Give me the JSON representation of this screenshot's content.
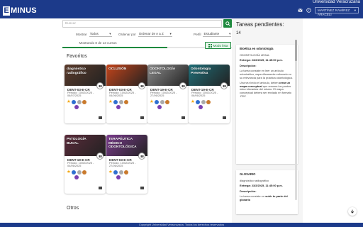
{
  "header": {
    "institution": "Universidad Veracruzana",
    "logo_initial": "E",
    "logo_rest": "MINUS",
    "user_name": "MARTÍNEZ RAMÍREZ ARACELI",
    "icons": [
      "mail-icon",
      "help-icon"
    ]
  },
  "search": {
    "placeholder": "Buscar",
    "button_icon": "search-icon"
  },
  "filters": {
    "show_label": "Mostrar",
    "show_value": "Todos",
    "order_label": "Ordenar por",
    "order_value": "Ordenar de A a Z",
    "profile_label": "Perfil",
    "profile_value": "Estudiante"
  },
  "showing_text": "Mostrando 8 de 13 cursos",
  "progress_fraction": 0.615,
  "mode_button": "Modo lista",
  "sections": {
    "favorites": "Favoritos",
    "others": "Otros"
  },
  "courses": [
    {
      "title": "diagnóstico radiográfico",
      "code": "DENT-03-E-CR",
      "period_1": "Periodo: 10/02/2025 -",
      "period_2": "06/07/2025",
      "color": "#5a3a2a"
    },
    {
      "title": "OCLUSIÓN",
      "code": "DENT-03-E-CR",
      "period_1": "Periodo: 10/02/2025 -",
      "period_2": "04/06/2025",
      "color": "#c4441a"
    },
    {
      "title": "ODONTOLOGÍA LEGAL",
      "code": "DENT-19-E-CR",
      "period_1": "Periodo: 10/02/2025 -",
      "period_2": "27/06/2025",
      "color": "#8a8a8a"
    },
    {
      "title": "Odontología Preventiva",
      "code": "DENT-19-E-CR",
      "period_1": "Periodo: 10/02/2025 -",
      "period_2": "06/06/2025",
      "color": "#1f6e78"
    },
    {
      "title": "PATOLOGÍA BUCAL",
      "code": "DENT-19-E-CR",
      "period_1": "Periodo: 10/02/2025 -",
      "period_2": "04/06/2025",
      "color": "#5a2b3a"
    },
    {
      "title": "TERAPÉUTICA MÉDICO ODONTOLÓGICA",
      "code": "DENT-03-E-CR",
      "period_1": "Periodo: 10/02/2025 -",
      "period_2": "27/06/2025",
      "color": "#7a3b8c"
    }
  ],
  "pending": {
    "title": "Tareas pendientes:",
    "count": "14",
    "tasks": [
      {
        "name": "Bioética en odontología",
        "course": "ODONTOLOGÍA LEGAL",
        "due": "Entrega: 23/2/2025, 11:45:00 p.m.",
        "desc_label": "Descripción:",
        "desc_1": "La tarea consiste en leer un artículo odontoético, específicamente enfocado en su relevancia para la práctica odontológica.",
        "desc_2_pre": "Una vez leído el artículo, deben ",
        "desc_2_bold": "crear un mapa conceptual",
        "desc_2_post": " que resuma los puntos más relevantes del mismo. El mapa conceptual deberá ser enviado en formato .PDF."
      },
      {
        "name": "GLOSARIO",
        "course": "diagnóstico radiográfico",
        "due": "Entrega: 23/2/2025, 11:45:00 p.m.",
        "desc_label": "Descripción:",
        "desc_pre": "La tarea consiste en ",
        "desc_bold": "subir tu parte del glosario"
      }
    ]
  },
  "footer": "Copyright Universidad Veracruzana. Todos los derechos reservados",
  "fab_icon": "arrow-down-icon"
}
